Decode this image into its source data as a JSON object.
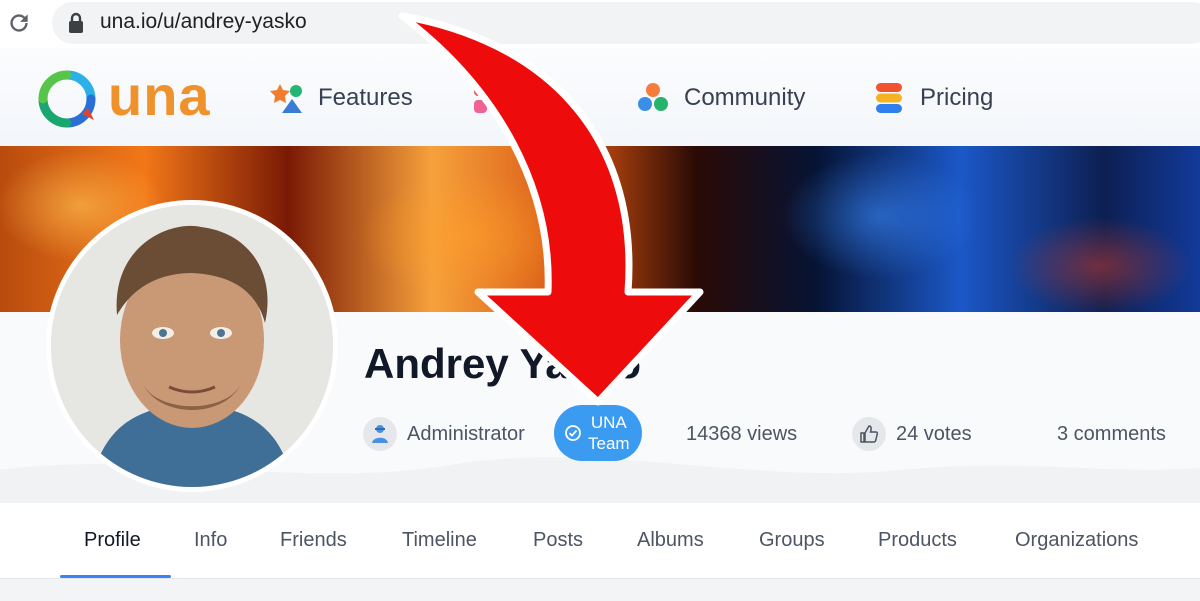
{
  "browser": {
    "url": "una.io/u/andrey-yasko"
  },
  "site": {
    "logo_text": "una",
    "nav": [
      {
        "label": "Features",
        "icon": "features-icon"
      },
      {
        "label": "",
        "icon": "apps-icon"
      },
      {
        "label": "Community",
        "icon": "community-icon"
      },
      {
        "label": "Pricing",
        "icon": "pricing-icon"
      }
    ]
  },
  "profile": {
    "name": "Andrey Yasko",
    "role": "Administrator",
    "badge_line1": "UNA",
    "badge_line2": "Team",
    "views": "14368 views",
    "votes": "24 votes",
    "comments": "3 comments"
  },
  "tabs": [
    "Profile",
    "Info",
    "Friends",
    "Timeline",
    "Posts",
    "Albums",
    "Groups",
    "Products",
    "Organizations"
  ],
  "colors": {
    "accent": "#3b82f6",
    "badge": "#3b9bf0",
    "arrow": "#ee0b0b",
    "logo_orange": "#f0922c"
  }
}
